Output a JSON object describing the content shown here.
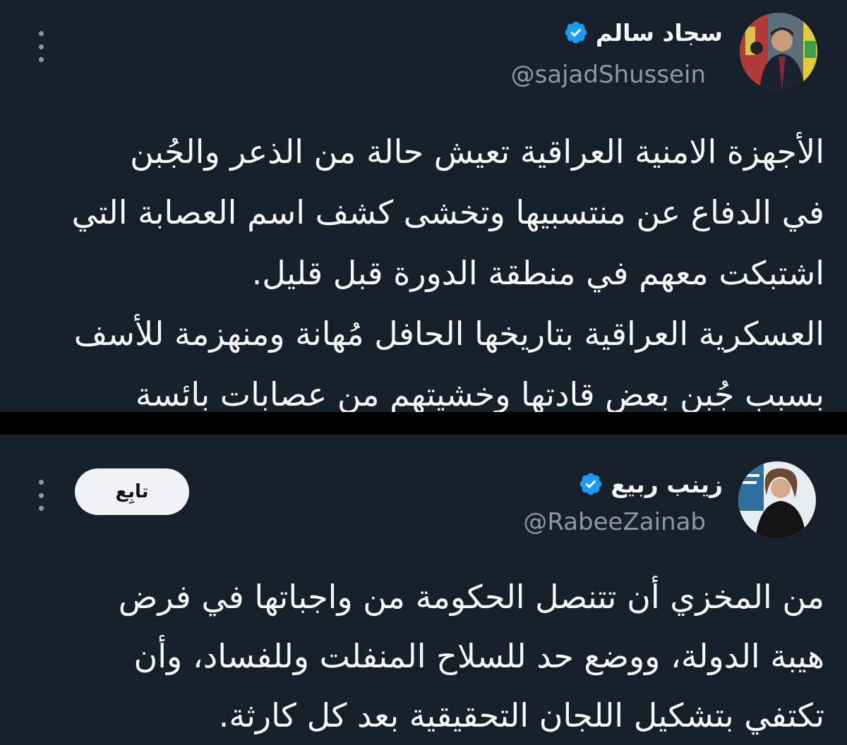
{
  "tweets": [
    {
      "author": {
        "display_name": "سجاد سالم",
        "handle": "@sajadShussein",
        "verified": true
      },
      "more_icon": "more-vertical-icon",
      "body_lines": [
        "الأجهزة الامنية العراقية تعيش حالة من الذعر والجُبن",
        "في الدفاع عن منتسبيها وتخشى كشف اسم العصابة التي",
        "اشتبكت معهم في منطقة الدورة قبل قليل.",
        "العسكرية العراقية بتاريخها الحافل مُهانة ومنهزمة للأسف",
        "بسبب جُبن بعض قادتها وخشيتهم من عصابات بائسة"
      ]
    },
    {
      "author": {
        "display_name": "زينب ربيع",
        "handle": "@RabeeZainab",
        "verified": true
      },
      "follow_label": "تابِع",
      "more_icon": "more-vertical-icon",
      "body_lines": [
        "من المخزي أن تتنصل الحكومة من واجباتها في فرض",
        "هيبة الدولة، ووضع حد للسلاح المنفلت وللفساد، وأن",
        "تكتفي بتشكيل اللجان التحقيقية بعد كل كارثة."
      ]
    }
  ],
  "colors": {
    "background": "#15202b",
    "separator": "#000000",
    "text": "#f7f9f9",
    "secondary_text": "#8b98a5",
    "verified_badge": "#1d9bf0",
    "follow_button_bg": "#eff3f4"
  }
}
